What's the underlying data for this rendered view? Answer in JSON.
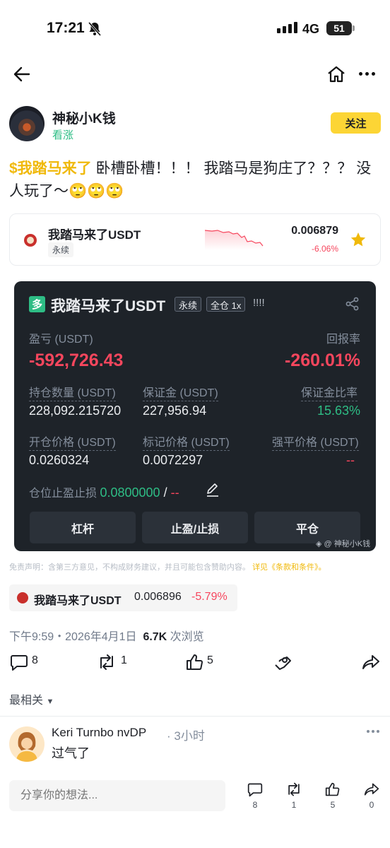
{
  "status_bar": {
    "time": "17:21",
    "network": "4G",
    "battery": "51"
  },
  "author": {
    "name": "神秘小K钱",
    "tag": "看涨",
    "follow_label": "关注"
  },
  "post": {
    "cashtag": "$我踏马来了",
    "text": " 卧槽卧槽！！！ 我踏马是狗庄了？？？ 没人玩了～🙄🙄🙄"
  },
  "coin_card": {
    "name": "我踏马来了USDT",
    "type": "永续",
    "price": "0.006879",
    "change": "-6.06%"
  },
  "pnl_card": {
    "badge": "多",
    "title": "我踏马来了USDT",
    "chips": [
      "永续",
      "全仓 1x"
    ],
    "exclaim": "!!!!",
    "pnl_label": "盈亏 (USDT)",
    "pnl_value": "-592,726.43",
    "roi_label": "回报率",
    "roi_value": "-260.01%",
    "position_size_label": "持仓数量 (USDT)",
    "position_size_value": "228,092.215720",
    "margin_label": "保证金 (USDT)",
    "margin_value": "227,956.94",
    "margin_ratio_label": "保证金比率",
    "margin_ratio_value": "15.63%",
    "entry_price_label": "开仓价格 (USDT)",
    "entry_price_value": "0.0260324",
    "mark_price_label": "标记价格 (USDT)",
    "mark_price_value": "0.0072297",
    "liq_price_label": "强平价格 (USDT)",
    "liq_price_value": "--",
    "tpsl_label": "仓位止盈止损",
    "tp_value": "0.0800000",
    "tpsl_sep": " / ",
    "sl_value": "--",
    "buttons": [
      "杠杆",
      "止盈/止损",
      "平仓"
    ],
    "watermark": "@ 神秘小K钱"
  },
  "disclaimer": {
    "text": "免责声明：含第三方意见，不构成财务建议，并且可能包含赞助内容。",
    "link": "详见《条款和条件》。"
  },
  "ticker": {
    "name": "我踏马来了USDT",
    "price": "0.006896",
    "change": "-5.79%"
  },
  "meta": {
    "datetime": "下午9:59・2026年4月1日",
    "views": "6.7K",
    "views_suffix": " 次浏览"
  },
  "actions": {
    "comments": "8",
    "reposts": "1",
    "likes": "5"
  },
  "sort_label": "最相关",
  "comment": {
    "author": "Keri Turnbo nvDP",
    "time": "· 3小时",
    "text": "过气了"
  },
  "bottom_bar": {
    "placeholder": "分享你的想法...",
    "comments": "8",
    "reposts": "1",
    "likes": "5",
    "shares": "0"
  },
  "colors": {
    "accent": "#fcd535",
    "up": "#2ebd85",
    "down": "#f6465d",
    "card_bg": "#1e2329"
  }
}
